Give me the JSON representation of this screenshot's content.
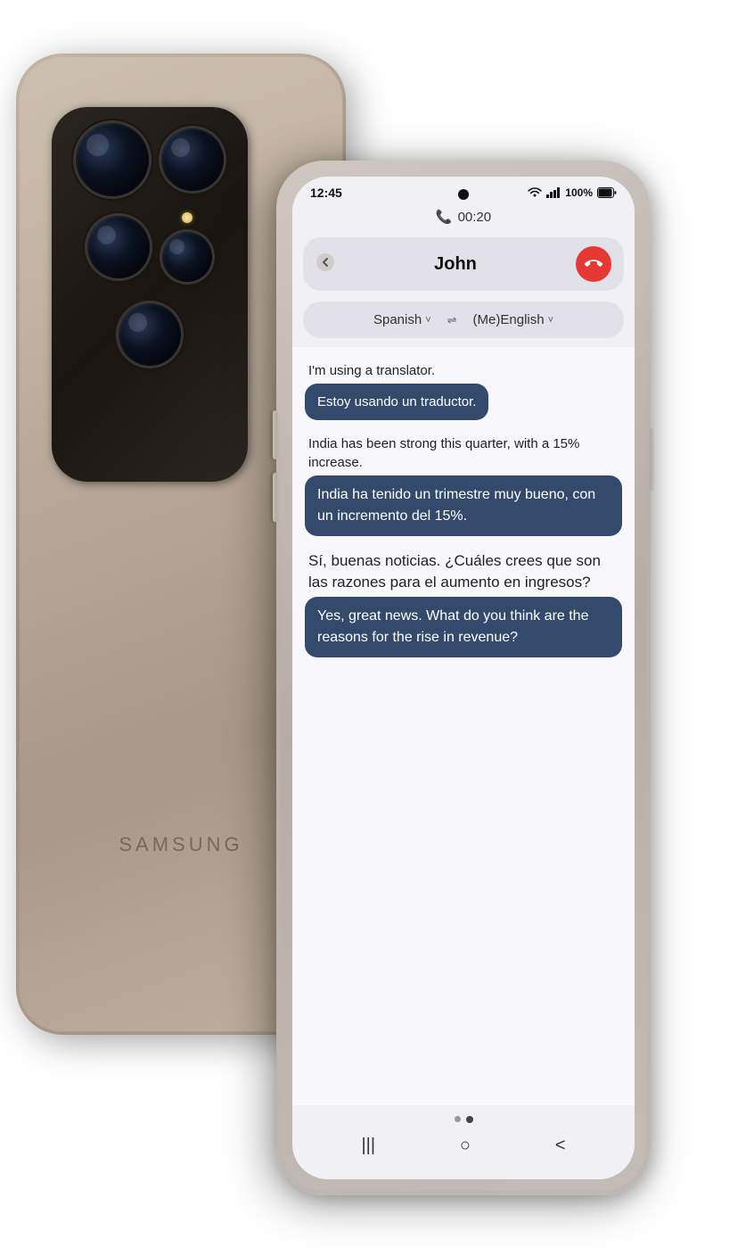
{
  "status_bar": {
    "time": "12:45",
    "wifi_icon": "wifi",
    "signal_icon": "signal",
    "battery": "100%"
  },
  "call": {
    "timer_label": "00:20",
    "phone_icon": "📞"
  },
  "translator": {
    "back_icon": "↩",
    "contact_name": "John",
    "end_call_icon": "📞",
    "lang_from": "Spanish",
    "lang_swap_icon": "⇌",
    "lang_to": "(Me)English",
    "chevron": "˅"
  },
  "chat": [
    {
      "plain": "I'm using a translator.",
      "translated": "Estoy usando un traductor."
    },
    {
      "plain": "India has been strong this quarter, with a 15% increase.",
      "translated": "India ha tenido un trimestre muy bueno, con un incremento del 15%."
    },
    {
      "plain": "Sí, buenas noticias. ¿Cuáles crees que son las razones para el aumento en ingresos?",
      "translated": "Yes, great news. What do you think are the reasons for the rise in revenue?"
    }
  ],
  "nav": {
    "dots": [
      "inactive",
      "active"
    ],
    "back_icon": "|||",
    "home_icon": "○",
    "recent_icon": "<"
  },
  "samsung_label": "SAMSUNG"
}
